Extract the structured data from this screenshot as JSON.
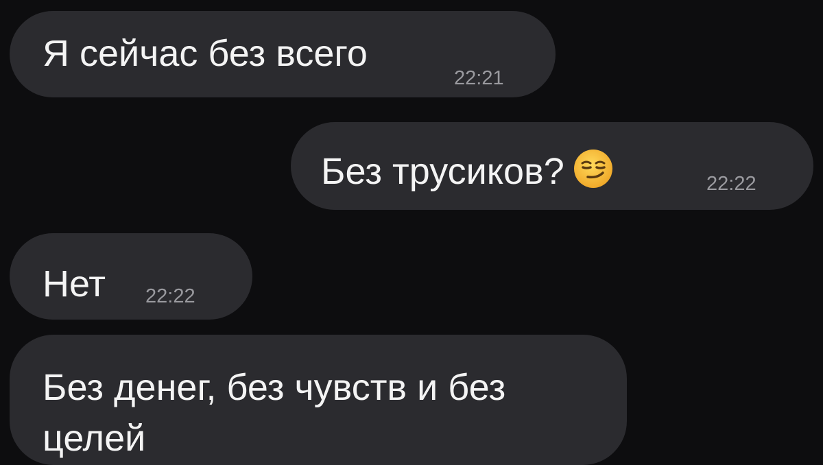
{
  "messages": [
    {
      "direction": "incoming",
      "text": "Я сейчас без всего",
      "time": "22:21"
    },
    {
      "direction": "outgoing",
      "text": "Без трусиков?",
      "emoji": "smirking-face",
      "time": "22:22"
    },
    {
      "direction": "incoming",
      "text": "Нет",
      "time": "22:22"
    },
    {
      "direction": "incoming",
      "text": "Без денег, без чувств и без целей"
    }
  ],
  "colors": {
    "background": "#0d0d0f",
    "bubble": "#2b2b2f",
    "text": "#f4f4f4",
    "time": "#9a9a9f"
  }
}
